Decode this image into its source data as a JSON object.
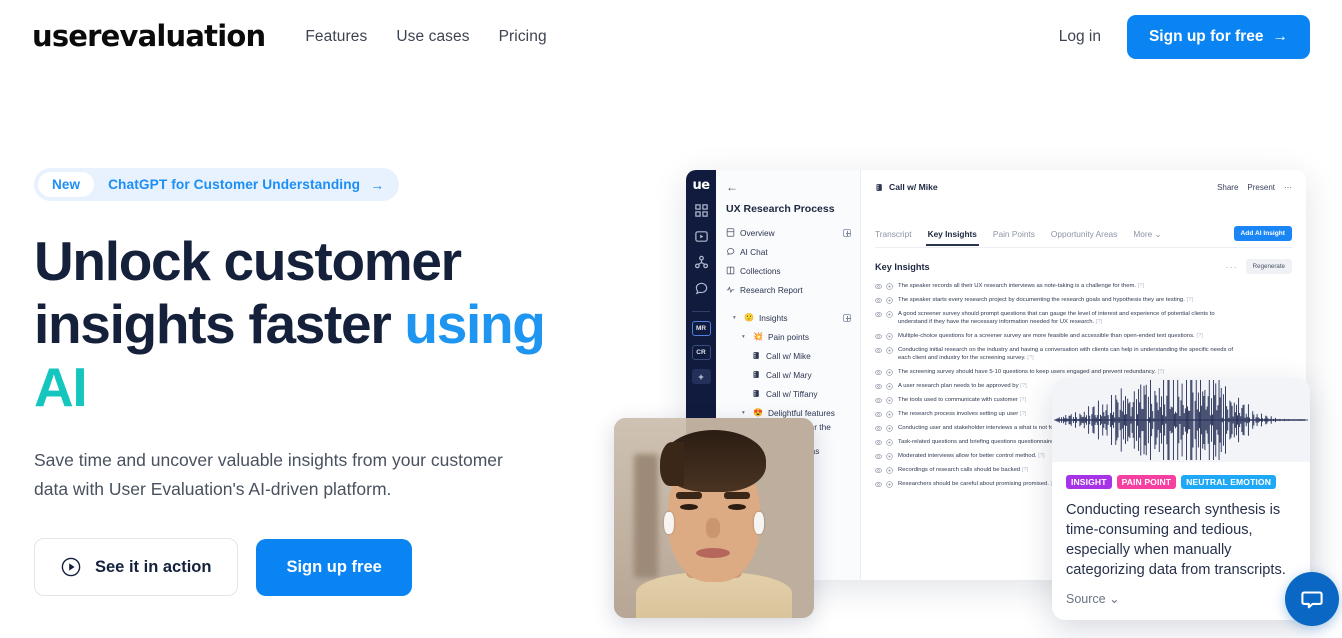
{
  "nav": {
    "logo": "userevaluation",
    "links": [
      {
        "label": "Features"
      },
      {
        "label": "Use cases"
      },
      {
        "label": "Pricing"
      }
    ],
    "login_label": "Log in",
    "signup_label": "Sign up for free",
    "signup_arrow": "→"
  },
  "hero": {
    "badge": {
      "new_label": "New",
      "text": "ChatGPT for Customer Understanding",
      "arrow": "→"
    },
    "title_line1": "Unlock customer",
    "title_line2": "insights faster ",
    "title_accent1": "using",
    "title_accent2": "AI",
    "subtitle": "Save time and uncover valuable insights from your customer data with User Evaluation's AI-driven platform.",
    "cta_secondary": "See it in action",
    "cta_primary": "Sign up free"
  },
  "colors": {
    "accent_blue": "#0b84f3",
    "accent_teal": "#15c6bf",
    "badge_bg": "#e7f2fe",
    "rail_navy": "#101b3d",
    "chat_blue": "#0b67c4",
    "tag_insight": "#a633e8",
    "tag_pain": "#f63fa0",
    "tag_emotion": "#1fa8f5"
  },
  "app": {
    "rail": {
      "logo": "ue",
      "chips": [
        "MR",
        "CR",
        "+"
      ]
    },
    "sidebar": {
      "back_icon": "←",
      "title": "UX Research Process",
      "items": [
        {
          "label": "Overview",
          "icon": "page-icon",
          "has_plus": true
        },
        {
          "label": "AI Chat",
          "icon": "chat-icon",
          "has_plus": false
        },
        {
          "label": "Collections",
          "icon": "columns-icon",
          "has_plus": false
        },
        {
          "label": "Research Report",
          "icon": "pulse-icon",
          "has_plus": false
        }
      ],
      "tree": [
        {
          "label": "Insights",
          "emoji": "🙂",
          "indent": 1,
          "caret": true,
          "has_plus": true
        },
        {
          "label": "Pain points",
          "emoji": "💥",
          "indent": 2,
          "caret": true,
          "has_plus": false
        },
        {
          "label": "Call w/ Mike",
          "emoji": "",
          "indent": 3,
          "caret": false,
          "has_plus": false
        },
        {
          "label": "Call w/ Mary",
          "emoji": "",
          "indent": 3,
          "caret": false,
          "has_plus": false
        },
        {
          "label": "Call w/ Tiffany",
          "emoji": "",
          "indent": 3,
          "caret": false,
          "has_plus": false
        },
        {
          "label": "Delightful features",
          "emoji": "😍",
          "indent": 2,
          "caret": true,
          "has_plus": false
        },
        {
          "label": "Questions for the next...",
          "emoji": "❓",
          "indent": 2,
          "caret": true,
          "has_plus": false
        },
        {
          "label": "Opportunity Areas",
          "emoji": "",
          "indent": 2,
          "caret": true,
          "has_plus": false
        }
      ]
    },
    "doc": {
      "title": "Call w/ Mike",
      "actions": [
        "Share",
        "Present",
        "···"
      ],
      "tabs": [
        {
          "label": "Transcript",
          "active": false
        },
        {
          "label": "Key Insights",
          "active": true
        },
        {
          "label": "Pain Points",
          "active": false
        },
        {
          "label": "Opportunity Areas",
          "active": false
        },
        {
          "label": "More ⌄",
          "active": false
        }
      ],
      "add_ai_label": "Add AI Insight",
      "section_title": "Key Insights",
      "regenerate_label": "Regenerate",
      "dots": "···",
      "insights": [
        "The speaker records all their UX research interviews as note-taking is a challenge for them.",
        "The speaker starts every research project by documenting the research goals and hypothesis they are testing.",
        "A good screener survey should prompt questions that can gauge the level of interest and experience of potential clients to understand if they have the necessary information needed for UX research.",
        "Multiple-choice questions for a screener survey are more feasible and accessible than open-ended text questions.",
        "Conducting initial research on the industry and having a conversation with clients can help in understanding the specific needs of each client and industry for the screening survey.",
        "The screening survey should have 5-10 questions to keep users engaged and prevent redundancy.",
        "A user research plan needs to be approved by",
        "The tools used to communicate with customer",
        "The research process involves setting up user",
        "Conducting user and stakeholder interviews a what is not for a project.",
        "Task-related questions and briefing questions questionnaire.",
        "Moderated interviews allow for better control method.",
        "Recordings of research calls should be backed",
        "Researchers should be careful about promising promised."
      ],
      "insight_suffix": "[?]"
    },
    "insight_card": {
      "tags": [
        "INSIGHT",
        "PAIN POINT",
        "NEUTRAL EMOTION"
      ],
      "text": "Conducting research synthesis is time-consuming and tedious, especially when manually categorizing data from transcripts.",
      "source_label": "Source ⌄"
    }
  },
  "chat_widget": {
    "icon": "chat-bubble-icon"
  }
}
